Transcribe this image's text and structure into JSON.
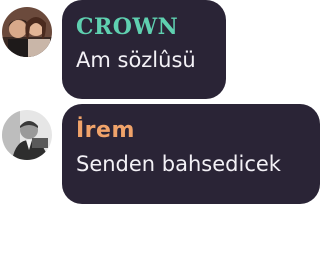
{
  "messages": [
    {
      "sender": "CROWN",
      "sender_color": "#5fd0b0",
      "text": "Am sözlûsü",
      "avatar": "group-photo-avatar"
    },
    {
      "sender": "İrem",
      "sender_color": "#f0a36a",
      "text": "Senden bahsedicek",
      "avatar": "black-and-white-portrait-avatar"
    }
  ],
  "colors": {
    "bubble_background": "#2a2436",
    "message_text": "#f3f1f6"
  }
}
